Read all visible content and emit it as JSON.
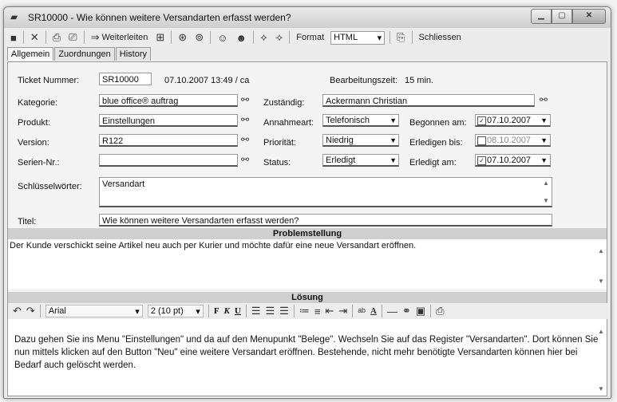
{
  "window": {
    "title": "SR10000 - Wie können weitere Versandarten erfasst werden?"
  },
  "toolbar": {
    "forward_label": "Weiterleiten",
    "format_label": "Format",
    "format_value": "HTML",
    "close_label": "Schliessen"
  },
  "tabs": [
    "Allgemein",
    "Zuordnungen",
    "History"
  ],
  "ticket": {
    "number_label": "Ticket Nummer:",
    "number_value": "SR10000",
    "created": "07.10.2007 13:49 / ca",
    "worktime_label": "Bearbeitungszeit:",
    "worktime_value": "15 min."
  },
  "fields": {
    "kategorie_label": "Kategorie:",
    "kategorie_value": "blue office® auftrag",
    "produkt_label": "Produkt:",
    "produkt_value": "Einstellungen",
    "version_label": "Version:",
    "version_value": "R122",
    "serien_label": "Serien-Nr.:",
    "serien_value": "",
    "schluessel_label": "Schlüsselwörter:",
    "schluessel_value": "Versandart",
    "titel_label": "Titel:",
    "titel_value": "Wie können weitere Versandarten erfasst werden?",
    "zustaendig_label": "Zuständig:",
    "zustaendig_value": "Ackermann Christian",
    "annahmeart_label": "Annahmeart:",
    "annahmeart_value": "Telefonisch",
    "prioritaet_label": "Priorität:",
    "prioritaet_value": "Niedrig",
    "status_label": "Status:",
    "status_value": "Erledigt",
    "begonnen_label": "Begonnen am:",
    "begonnen_value": "07.10.2007",
    "erledigen_label": "Erledigen bis:",
    "erledigen_value": "08.10.2007",
    "erledigt_label": "Erledigt am:",
    "erledigt_value": "07.10.2007"
  },
  "problem": {
    "header": "Problemstellung",
    "text": "Der Kunde verschickt seine Artikel neu auch per Kurier und möchte dafür eine neue Versandart eröffnen."
  },
  "solution": {
    "header": "Lösung",
    "font": "Arial",
    "size": "2 (10 pt)",
    "text": "Dazu gehen Sie ins Menu \"Einstellungen\" und da auf den Menupunkt \"Belege\". Wechseln Sie auf das Register \"Versandarten\". Dort können Sie nun mittels klicken auf den Button \"Neu\" eine weitere Versandart eröffnen. Bestehende, nicht mehr benötigte Versandarten können hier bei Bedarf auch gelöscht werden."
  }
}
